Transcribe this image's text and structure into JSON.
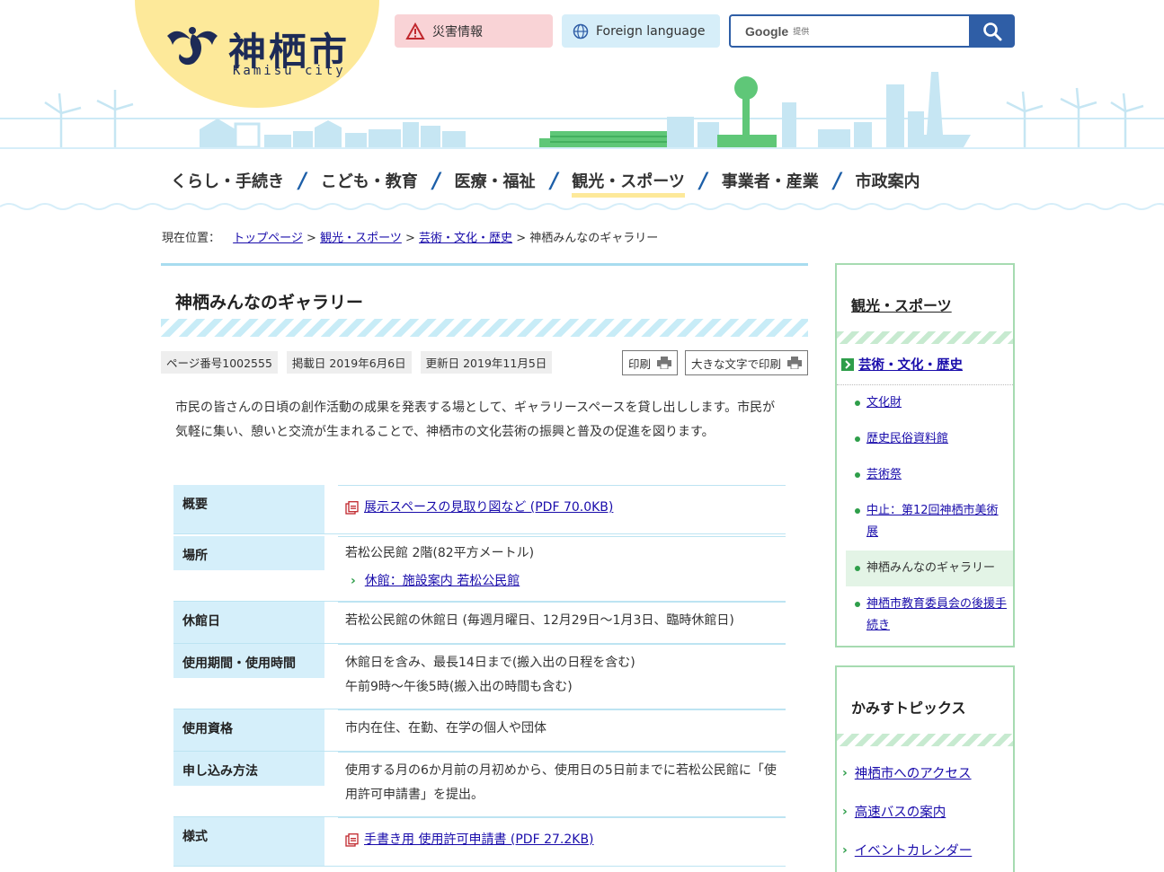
{
  "header": {
    "logo_name": "神栖市",
    "logo_sub": "Kamisu city",
    "disaster_label": "災害情報",
    "foreign_label": "Foreign language",
    "search_brand": "Google",
    "search_provided": "提供"
  },
  "nav": {
    "items": [
      {
        "label": "くらし・手続き"
      },
      {
        "label": "こども・教育"
      },
      {
        "label": "医療・福祉"
      },
      {
        "label": "観光・スポーツ"
      },
      {
        "label": "事業者・産業"
      },
      {
        "label": "市政案内"
      }
    ],
    "separator": "/"
  },
  "breadcrumb": {
    "label": "現在位置：",
    "links": [
      "トップページ",
      "観光・スポーツ",
      "芸術・文化・歴史"
    ],
    "sep": ">",
    "current": "神栖みんなのギャラリー"
  },
  "main": {
    "title": "神栖みんなのギャラリー",
    "page_no": "ページ番号1002555",
    "published": "掲載日 2019年6月6日",
    "updated": "更新日 2019年11月5日",
    "print_label": "印刷",
    "print_large_label": "大きな文字で印刷",
    "intro": "市民の皆さんの日頃の創作活動の成果を発表する場として、ギャラリースペースを貸し出しします。市民が気軽に集い、憩いと交流が生まれることで、神栖市の文化芸術の振興と普及の促進を図ります。",
    "rows": [
      {
        "th": "概要",
        "link": "展示スペースの見取り図など (PDF 70.0KB)"
      },
      {
        "th": "場所",
        "text": "若松公民館 2階(82平方メートル)",
        "link": "休館：施設案内 若松公民館"
      },
      {
        "th": "休館日",
        "text": "若松公民館の休館日 (毎週月曜日、12月29日～1月3日、臨時休館日)"
      },
      {
        "th": "使用期間・使用時間",
        "text": "休館日を含み、最長14日まで(搬入出の日程を含む)",
        "text2": "午前9時～午後5時(搬入出の時間も含む)"
      },
      {
        "th": "使用資格",
        "text": "市内在住、在勤、在学の個人や団体"
      },
      {
        "th": "申し込み方法",
        "text": "使用する月の6か月前の月初めから、使用日の5日前までに若松公民館に「使用許可申請書」を提出。"
      },
      {
        "th": "様式",
        "link": "手書き用 使用許可申請書 (PDF 27.2KB)"
      }
    ]
  },
  "sidebar": {
    "heading": "観光・スポーツ",
    "sub": "芸術・文化・歴史",
    "items": [
      {
        "label": "文化財"
      },
      {
        "label": "歴史民俗資料館"
      },
      {
        "label": "芸術祭"
      },
      {
        "label": "中止：第12回神栖市美術展"
      },
      {
        "label": "神栖みんなのギャラリー"
      },
      {
        "label": "神栖市教育委員会の後援手続き"
      }
    ]
  },
  "topics": {
    "heading": "かみすトピックス",
    "items": [
      {
        "label": "神栖市へのアクセス"
      },
      {
        "label": "高速バスの案内"
      },
      {
        "label": "イベントカレンダー"
      }
    ]
  },
  "colors": {
    "accent_blue": "#2f5ea6",
    "nav_slash": "#1d5fa8",
    "logo_yellow": "#fde99a",
    "table_header": "#d5effa",
    "sidebar_green": "#a6dbb1"
  }
}
